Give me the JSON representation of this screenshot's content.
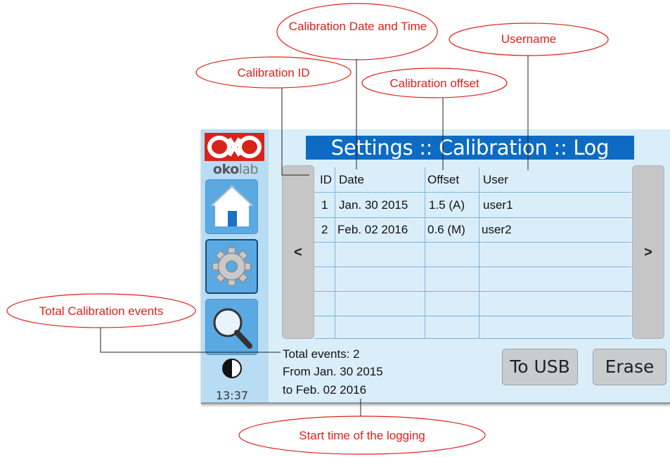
{
  "screen": {
    "logo_text_bold": "oko",
    "logo_text_rest": "lab",
    "title": "Settings :: Calibration :: Log",
    "clock": "13:37",
    "nav": {
      "prev": "<",
      "next": ">"
    },
    "table": {
      "headers": {
        "id": "ID",
        "date": "Date",
        "offset": "Offset",
        "user": "User"
      },
      "rows": [
        {
          "id": "1",
          "date": "Jan. 30 2015",
          "offset": "1.5 (A)",
          "user": "user1"
        },
        {
          "id": "2",
          "date": "Feb. 02 2016",
          "offset": "0.6 (M)",
          "user": "user2"
        }
      ]
    },
    "footer": {
      "total": "Total events: 2",
      "from": "From Jan. 30 2015",
      "to": "to Feb. 02 2016",
      "help": "?"
    },
    "buttons": {
      "to_usb": "To USB",
      "erase": "Erase"
    },
    "icons": {
      "home": "home-icon",
      "settings": "gear-icon",
      "search": "search-icon",
      "contrast": "contrast-icon",
      "help": "help-icon"
    },
    "colors": {
      "title_bar": "#0e6bc4",
      "screen_bg": "#daeefa",
      "button_blue": "#5aa9e2",
      "logo_red": "#d9231a"
    }
  },
  "annotations": {
    "calibration_date_time": "Calibration Date and Time",
    "username": "Username",
    "calibration_id": "Calibration ID",
    "calibration_offset": "Calibration offset",
    "total_calibration_events": "Total Calibration events",
    "start_time": "Start time of the logging",
    "color": "#e0201b"
  }
}
